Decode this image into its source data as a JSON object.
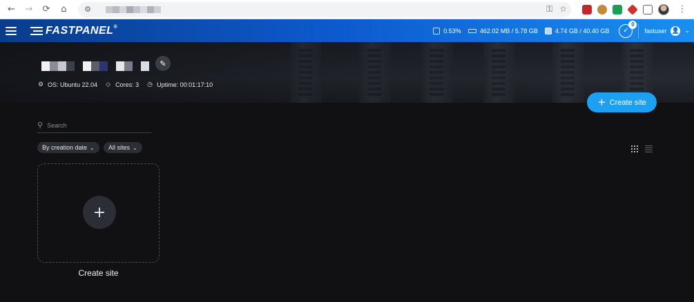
{
  "browser": {
    "back": "←",
    "forward": "→",
    "reload": "⟳",
    "home": "⌂",
    "site_info": "⚙",
    "key": "⚿",
    "star": "☆",
    "menu": "⋮"
  },
  "app": {
    "logo": "FASTPANEL",
    "logo_reg": "®"
  },
  "stats": {
    "cpu": "0.53%",
    "ram": "462.02 MB / 5.78 GB",
    "disk": "4.74 GB / 40.40 GB",
    "tasks_count": "0"
  },
  "user": {
    "name": "fastuser",
    "avatar": "👤",
    "caret": "⌄"
  },
  "server": {
    "edit_icon": "✎",
    "os": "OS: Ubuntu 22.04",
    "cores": "Cores: 3",
    "uptime": "Uptime: 00:01:17:10"
  },
  "actions": {
    "create_site": "Create site",
    "plus": "+"
  },
  "filters": {
    "search_placeholder": "Search",
    "sort": "By creation date",
    "scope": "All sites",
    "chev": "⌄"
  },
  "tile": {
    "plus": "+",
    "label": "Create site"
  },
  "colors": {
    "accent": "#1ba0f2",
    "topbar_start": "#0a3c8c",
    "topbar_end": "#1a8ff0",
    "background": "#111114"
  }
}
